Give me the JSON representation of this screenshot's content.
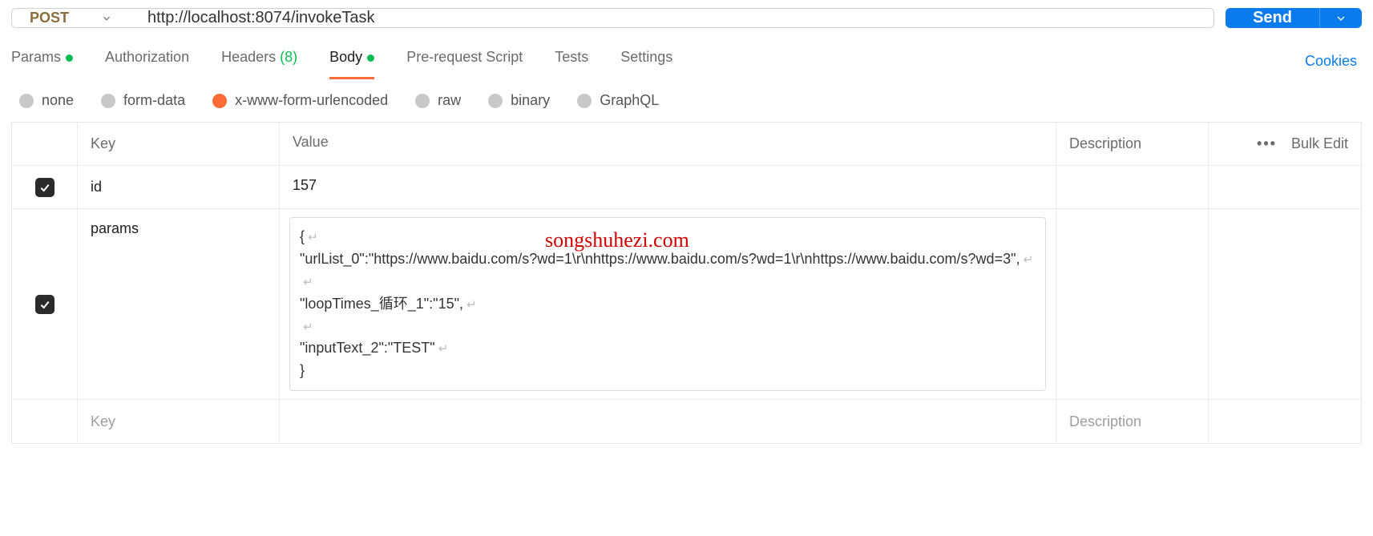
{
  "request": {
    "method": "POST",
    "url": "http://localhost:8074/invokeTask",
    "send_label": "Send"
  },
  "tabs": {
    "params": "Params",
    "authorization": "Authorization",
    "headers_label": "Headers",
    "headers_count": "(8)",
    "body": "Body",
    "pre_request": "Pre-request Script",
    "tests": "Tests",
    "settings": "Settings",
    "cookies": "Cookies"
  },
  "body_types": {
    "none": "none",
    "form_data": "form-data",
    "urlencoded": "x-www-form-urlencoded",
    "raw": "raw",
    "binary": "binary",
    "graphql": "GraphQL",
    "selected": "urlencoded"
  },
  "table": {
    "headers": {
      "key": "Key",
      "value": "Value",
      "description": "Description"
    },
    "bulk_edit": "Bulk Edit",
    "rows": [
      {
        "enabled": true,
        "key": "id",
        "value_plain": "157",
        "description": ""
      },
      {
        "enabled": true,
        "key": "params",
        "value_lines": [
          "{",
          "\"urlList_0\":\"https://www.baidu.com/s?wd=1\\r\\nhttps://www.baidu.com/s?wd=1\\r\\nhttps://www.baidu.com/s?wd=3\",",
          "",
          "\"loopTimes_循环_1\":\"15\",",
          "",
          "\"inputText_2\":\"TEST\"",
          "}"
        ],
        "description": ""
      }
    ],
    "placeholder_row": {
      "key": "Key",
      "description": "Description"
    }
  },
  "watermark": "songshuhezi.com"
}
